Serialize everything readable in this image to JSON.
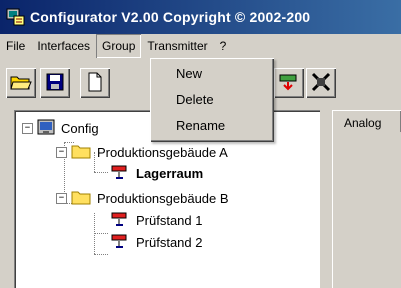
{
  "window": {
    "title": "Configurator  V2.00 Copyright © 2002-200"
  },
  "menubar": {
    "items": [
      "File",
      "Interfaces",
      "Group",
      "Transmitter",
      "?"
    ],
    "active": "Group"
  },
  "group_menu": {
    "items": [
      "New",
      "Delete",
      "Rename"
    ]
  },
  "toolbar": {
    "buttons": [
      "open-folder-icon",
      "save-disk-icon",
      "new-document-icon",
      "transmitter-icon",
      "disconnect-icon"
    ]
  },
  "tree": {
    "root": "Config",
    "groups": [
      {
        "label": "Produktionsgebäude A",
        "items": [
          "Lagerraum"
        ]
      },
      {
        "label": "Produktionsgebäude B",
        "items": [
          "Prüfstand 1",
          "Prüfstand 2"
        ]
      }
    ],
    "selected": "Lagerraum"
  },
  "right_panel": {
    "tab_label": "Analog"
  }
}
